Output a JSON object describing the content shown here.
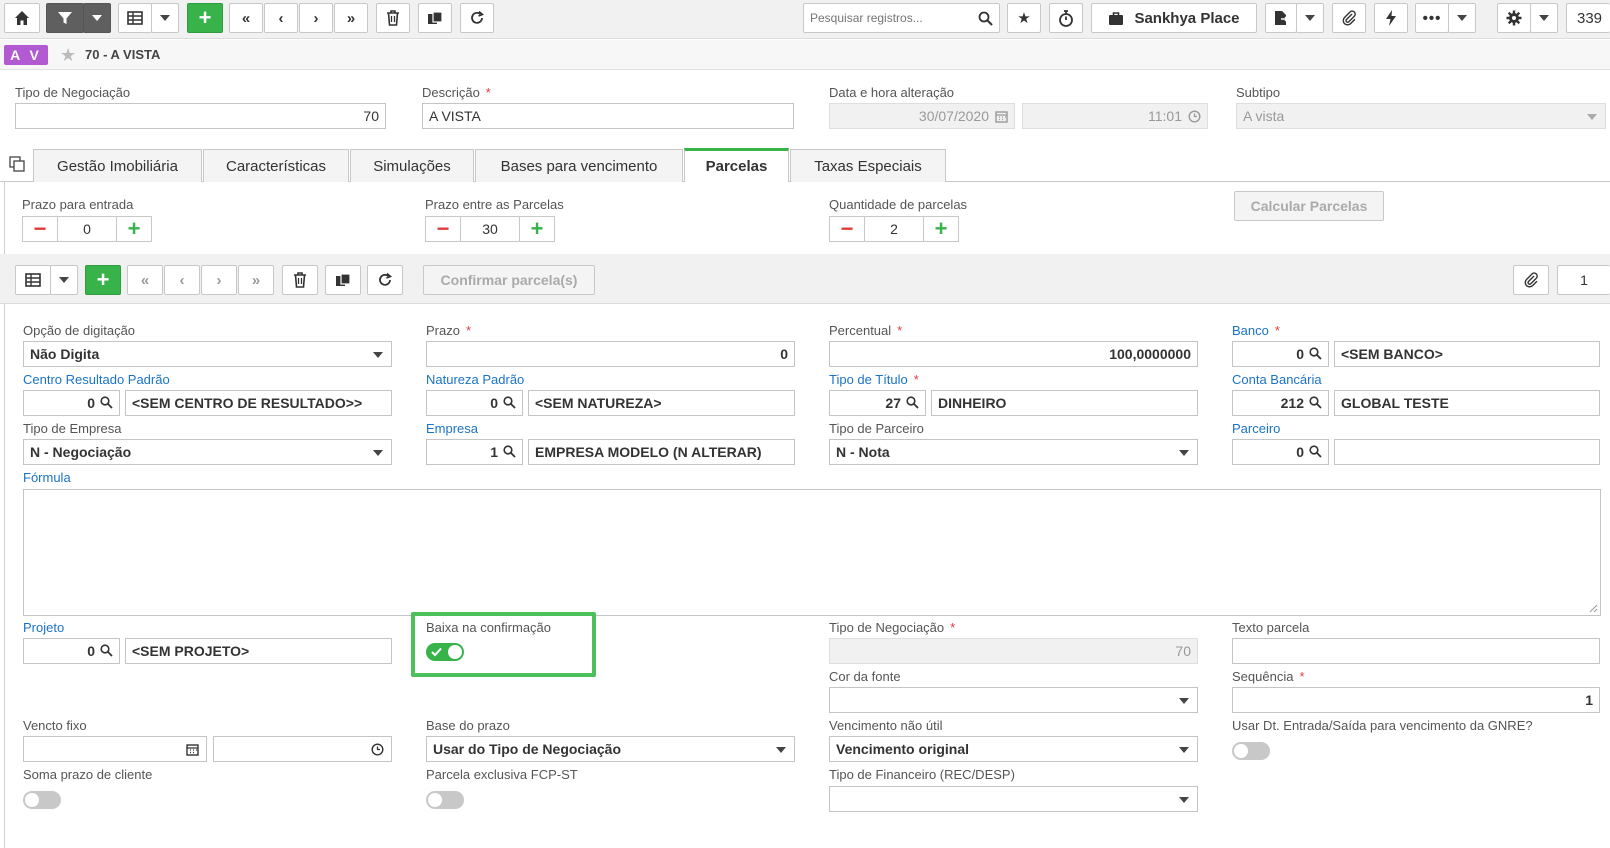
{
  "toolbar": {
    "search_placeholder": "Pesquisar registros...",
    "sankhya_place": "Sankhya Place",
    "counter": "339"
  },
  "record": {
    "badge": "A V",
    "title": "70 - A VISTA"
  },
  "header_fields": {
    "tipo_label": "Tipo de Negociação",
    "tipo_value": "70",
    "descricao_label": "Descrição",
    "descricao_value": "A VISTA",
    "data_label": "Data e hora alteração",
    "data_value": "30/07/2020",
    "hora_value": "11:01",
    "subtipo_label": "Subtipo",
    "subtipo_value": "A vista"
  },
  "tabs": [
    "Gestão Imobiliária",
    "Características",
    "Simulações",
    "Bases para vencimento",
    "Parcelas",
    "Taxas Especiais"
  ],
  "steppers": {
    "entrada_label": "Prazo para entrada",
    "entrada_value": "0",
    "entre_label": "Prazo entre as Parcelas",
    "entre_value": "30",
    "qtd_label": "Quantidade de parcelas",
    "qtd_value": "2",
    "calc_button": "Calcular Parcelas"
  },
  "grid_toolbar": {
    "confirm_button": "Confirmar parcela(s)",
    "page": "1"
  },
  "form": {
    "opcao_label": "Opção de digitação",
    "opcao_value": "Não Digita",
    "prazo_label": "Prazo",
    "prazo_value": "0",
    "percentual_label": "Percentual",
    "percentual_value": "100,0000000",
    "banco_label": "Banco",
    "banco_code": "0",
    "banco_value": "<SEM BANCO>",
    "cr_label": "Centro Resultado Padrão",
    "cr_code": "0",
    "cr_value": "<SEM CENTRO DE RESULTADO>>",
    "natureza_label": "Natureza Padrão",
    "natureza_code": "0",
    "natureza_value": "<SEM NATUREZA>",
    "titulo_label": "Tipo de Título",
    "titulo_code": "27",
    "titulo_value": "DINHEIRO",
    "conta_label": "Conta Bancária",
    "conta_code": "212",
    "conta_value": "GLOBAL TESTE",
    "tipoemp_label": "Tipo de Empresa",
    "tipoemp_value": "N - Negociação",
    "empresa_label": "Empresa",
    "empresa_code": "1",
    "empresa_value": "EMPRESA MODELO (N ALTERAR)",
    "tipoparc_label": "Tipo de Parceiro",
    "tipoparc_value": "N - Nota",
    "parceiro_label": "Parceiro",
    "parceiro_code": "0",
    "parceiro_value": "",
    "formula_label": "Fórmula",
    "projeto_label": "Projeto",
    "projeto_code": "0",
    "projeto_value": "<SEM PROJETO>",
    "baixa_label": "Baixa na confirmação",
    "tiponeg_label": "Tipo de Negociação",
    "tiponeg_value": "70",
    "texto_label": "Texto parcela",
    "texto_value": "",
    "cor_label": "Cor da fonte",
    "cor_value": "",
    "seq_label": "Sequência",
    "seq_value": "1",
    "vencto_label": "Vencto fixo",
    "base_label": "Base do prazo",
    "base_value": "Usar do Tipo de Negociação",
    "vnu_label": "Vencimento não útil",
    "vnu_value": "Vencimento original",
    "gnre_label": "Usar Dt. Entrada/Saída para vencimento da GNRE?",
    "soma_label": "Soma prazo de cliente",
    "fcp_label": "Parcela exclusiva FCP-ST",
    "fin_label": "Tipo de Financeiro (REC/DESP)",
    "fin_value": ""
  },
  "colors": {
    "accent": "#37b34a",
    "required": "#e23b3b",
    "badge": "#b25ad1",
    "link": "#1a73c8"
  }
}
